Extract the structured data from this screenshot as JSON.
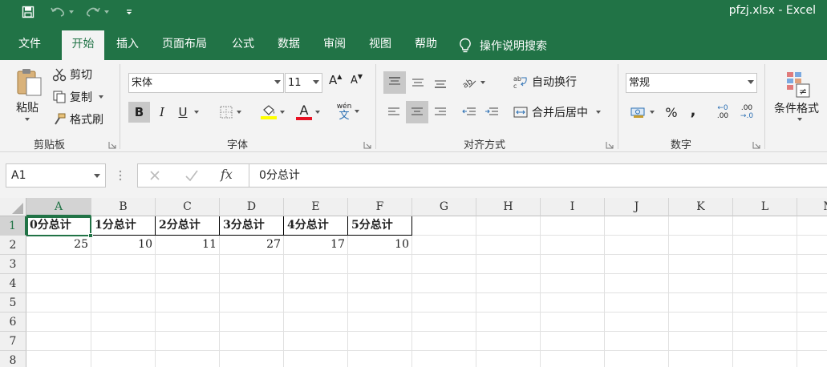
{
  "window": {
    "title": "pfzj.xlsx  -  Excel"
  },
  "tabs": [
    "文件",
    "开始",
    "插入",
    "页面布局",
    "公式",
    "数据",
    "审阅",
    "视图",
    "帮助"
  ],
  "tell_me": "操作说明搜索",
  "ribbon": {
    "clipboard": {
      "paste": "粘贴",
      "cut": "剪切",
      "copy": "复制",
      "format_painter": "格式刷",
      "label": "剪贴板"
    },
    "font": {
      "name": "宋体",
      "size": "11",
      "bold": "B",
      "italic": "I",
      "underline": "U",
      "font_color_glyph": "A",
      "grow": "A",
      "shrink": "A",
      "phonetic_top": "wén",
      "phonetic_bottom": "文",
      "label": "字体"
    },
    "alignment": {
      "wrap": "自动换行",
      "merge": "合并后居中",
      "label": "对齐方式"
    },
    "number": {
      "format": "常规",
      "percent": "%",
      "comma": ",",
      "inc_top": "←0",
      "inc_bottom": ".00",
      "dec_top": ".00",
      "dec_bottom": "→.0",
      "label": "数字"
    },
    "styles": {
      "conditional": "条件格式"
    }
  },
  "formula_bar": {
    "name_box": "A1",
    "formula": "0分总计",
    "fx": "fx"
  },
  "columns": [
    "A",
    "B",
    "C",
    "D",
    "E",
    "F",
    "G",
    "H",
    "I",
    "J",
    "K",
    "L",
    "M"
  ],
  "rows": [
    "1",
    "2",
    "3",
    "4",
    "5",
    "6",
    "7",
    "8"
  ],
  "sheet": {
    "headers": [
      "0分总计",
      "1分总计",
      "2分总计",
      "3分总计",
      "4分总计",
      "5分总计"
    ],
    "values": [
      "25",
      "10",
      "11",
      "27",
      "17",
      "10"
    ]
  },
  "colors": {
    "accent": "#217346",
    "font_color_bar": "#e81123",
    "fill_color_bar": "#ffff00"
  }
}
